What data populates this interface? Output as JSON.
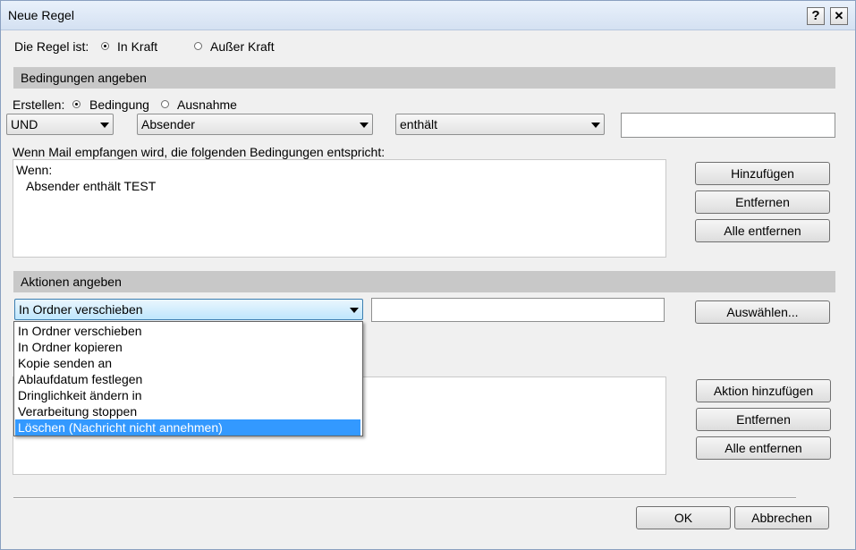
{
  "window": {
    "title": "Neue Regel",
    "help_glyph": "?",
    "close_glyph": "✕"
  },
  "status": {
    "label": "Die Regel ist:",
    "options": [
      "In Kraft",
      "Außer Kraft"
    ],
    "selected": 0
  },
  "conditions": {
    "header": "Bedingungen angeben",
    "create_label": "Erstellen:",
    "create_options": [
      "Bedingung",
      "Ausnahme"
    ],
    "create_selected": 0,
    "logic_value": "UND",
    "field_value": "Absender",
    "operator_value": "enthält",
    "value_input": "",
    "description": "Wenn Mail empfangen wird, die folgenden Bedingungen entspricht:",
    "list": {
      "heading": "Wenn:",
      "items": [
        "Absender enthält TEST"
      ]
    },
    "buttons": {
      "add": "Hinzufügen",
      "remove": "Entfernen",
      "remove_all": "Alle entfernen"
    }
  },
  "actions": {
    "header": "Aktionen angeben",
    "action_value": "In Ordner verschieben",
    "target_input": "",
    "select_button": "Auswählen...",
    "dropdown_options": [
      "In Ordner verschieben",
      "In Ordner kopieren",
      "Kopie senden an",
      "Ablaufdatum festlegen",
      "Dringlichkeit ändern in",
      "Verarbeitung stoppen",
      "Löschen (Nachricht nicht annehmen)"
    ],
    "dropdown_highlighted": 6,
    "buttons": {
      "add": "Aktion hinzufügen",
      "remove": "Entfernen",
      "remove_all": "Alle entfernen"
    }
  },
  "footer": {
    "ok": "OK",
    "cancel": "Abbrechen"
  },
  "colors": {
    "section_bg": "#c8c8c8",
    "highlight": "#3399ff",
    "dialog_bg": "#f0f0f0"
  }
}
